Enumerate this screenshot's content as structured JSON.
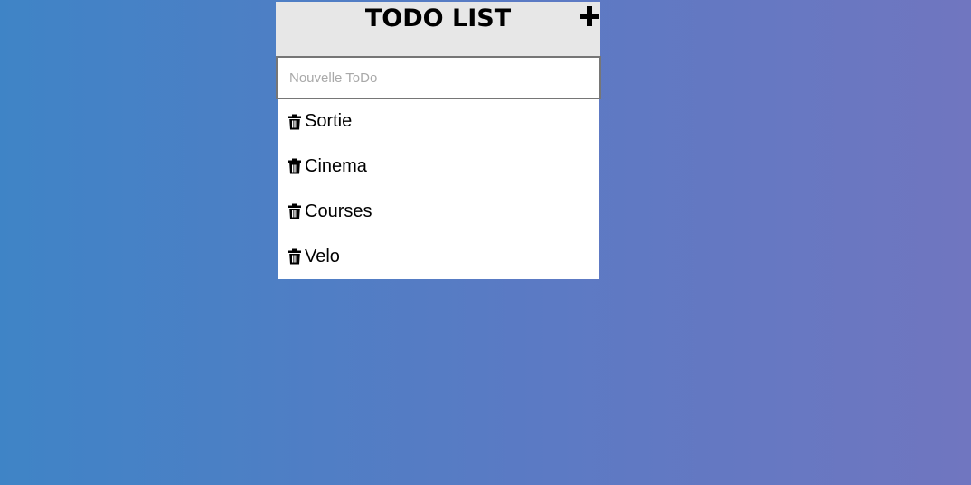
{
  "header": {
    "title": "TODO LIST",
    "add_icon": "plus-icon"
  },
  "input": {
    "placeholder": "Nouvelle ToDo",
    "value": ""
  },
  "todos": [
    {
      "label": "Sortie",
      "icon": "trash-icon"
    },
    {
      "label": "Cinema",
      "icon": "trash-icon"
    },
    {
      "label": "Courses",
      "icon": "trash-icon"
    },
    {
      "label": "Velo",
      "icon": "trash-icon"
    }
  ],
  "colors": {
    "background_start": "#3f84c6",
    "background_end": "#7076c0",
    "header_bg": "#e7e7e7"
  }
}
